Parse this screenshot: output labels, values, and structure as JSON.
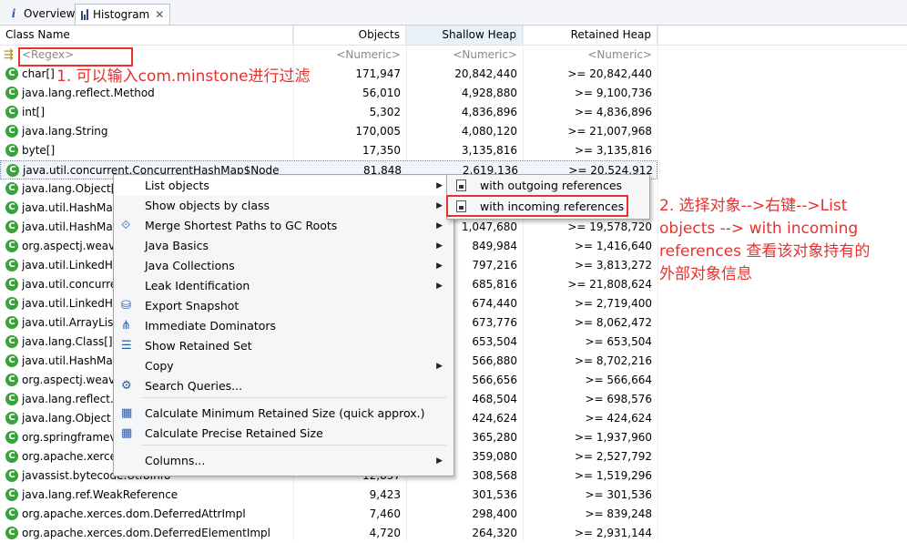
{
  "tabs": [
    {
      "label": "Overview",
      "icon": "info-icon"
    },
    {
      "label": "Histogram",
      "icon": "histogram-icon",
      "active": true
    }
  ],
  "columns": {
    "name": "Class Name",
    "objects": "Objects",
    "shallow": "Shallow Heap",
    "retained": "Retained Heap"
  },
  "filter_row": {
    "name_placeholder": "<Regex>",
    "objects_placeholder": "<Numeric>",
    "shallow_placeholder": "<Numeric>",
    "retained_placeholder": "<Numeric>"
  },
  "rows": [
    {
      "name": "char[]",
      "objects": "171,947",
      "shallow": "20,842,440",
      "retained": ">= 20,842,440"
    },
    {
      "name": "java.lang.reflect.Method",
      "objects": "56,010",
      "shallow": "4,928,880",
      "retained": ">= 9,100,736"
    },
    {
      "name": "int[]",
      "objects": "5,302",
      "shallow": "4,836,896",
      "retained": ">= 4,836,896"
    },
    {
      "name": "java.lang.String",
      "objects": "170,005",
      "shallow": "4,080,120",
      "retained": ">= 21,007,968"
    },
    {
      "name": "byte[]",
      "objects": "17,350",
      "shallow": "3,135,816",
      "retained": ">= 3,135,816"
    },
    {
      "name": "java.util.concurrent.ConcurrentHashMap$Node",
      "objects": "81,848",
      "shallow": "2,619,136",
      "retained": ">= 20,524,912"
    },
    {
      "name": "java.lang.Object[]",
      "objects": "",
      "shallow": "",
      "retained": ""
    },
    {
      "name": "java.util.HashMap",
      "objects": "",
      "shallow": "",
      "retained": ""
    },
    {
      "name": "java.util.HashMap",
      "objects": "",
      "shallow": "1,047,680",
      "retained": ">= 19,578,720"
    },
    {
      "name": "org.aspectj.weave",
      "objects": "",
      "shallow": "849,984",
      "retained": ">= 1,416,640"
    },
    {
      "name": "java.util.LinkedHa",
      "objects": "",
      "shallow": "797,216",
      "retained": ">= 3,813,272"
    },
    {
      "name": "java.util.concurrer",
      "objects": "",
      "shallow": "685,816",
      "retained": ">= 21,808,624"
    },
    {
      "name": "java.util.LinkedHa",
      "objects": "",
      "shallow": "674,440",
      "retained": ">= 2,719,400"
    },
    {
      "name": "java.util.ArrayList",
      "objects": "",
      "shallow": "673,776",
      "retained": ">= 8,062,472"
    },
    {
      "name": "java.lang.Class[]",
      "objects": "",
      "shallow": "653,504",
      "retained": ">= 653,504"
    },
    {
      "name": "java.util.HashMap",
      "objects": "",
      "shallow": "566,880",
      "retained": ">= 8,702,216"
    },
    {
      "name": "org.aspectj.weave",
      "objects": "",
      "shallow": "566,656",
      "retained": ">= 566,664"
    },
    {
      "name": "java.lang.reflect.F",
      "objects": "",
      "shallow": "468,504",
      "retained": ">= 698,576"
    },
    {
      "name": "java.lang.Object",
      "objects": "",
      "shallow": "424,624",
      "retained": ">= 424,624"
    },
    {
      "name": "org.springframev",
      "objects": "",
      "shallow": "365,280",
      "retained": ">= 1,937,960"
    },
    {
      "name": "org.apache.xerce",
      "objects": "",
      "shallow": "359,080",
      "retained": ">= 2,527,792"
    },
    {
      "name": "javassist.bytecode.Utf8Info",
      "objects": "12,857",
      "shallow": "308,568",
      "retained": ">= 1,519,296"
    },
    {
      "name": "java.lang.ref.WeakReference",
      "objects": "9,423",
      "shallow": "301,536",
      "retained": ">= 301,536"
    },
    {
      "name": "org.apache.xerces.dom.DeferredAttrImpl",
      "objects": "7,460",
      "shallow": "298,400",
      "retained": ">= 839,248"
    },
    {
      "name": "org.apache.xerces.dom.DeferredElementImpl",
      "objects": "4,720",
      "shallow": "264,320",
      "retained": ">= 2,931,144"
    }
  ],
  "context_menu": {
    "items": [
      {
        "label": "List objects",
        "icon": "",
        "submenu": true
      },
      {
        "label": "Show objects by class",
        "icon": "",
        "submenu": true
      },
      {
        "label": "Merge Shortest Paths to GC Roots",
        "icon": "merge-paths-icon",
        "submenu": true
      },
      {
        "label": "Java Basics",
        "icon": "",
        "submenu": true
      },
      {
        "label": "Java Collections",
        "icon": "",
        "submenu": true
      },
      {
        "label": "Leak Identification",
        "icon": "",
        "submenu": true
      },
      {
        "label": "Export Snapshot",
        "icon": "database-icon",
        "submenu": false
      },
      {
        "label": "Immediate Dominators",
        "icon": "dominators-icon",
        "submenu": false
      },
      {
        "label": "Show Retained Set",
        "icon": "retained-set-icon",
        "submenu": false
      },
      {
        "label": "Copy",
        "icon": "",
        "submenu": true
      },
      {
        "label": "Search Queries...",
        "icon": "search-queries-icon",
        "submenu": false
      },
      {
        "label": "Calculate Minimum Retained Size (quick approx.)",
        "icon": "calculator-icon",
        "submenu": false
      },
      {
        "label": "Calculate Precise Retained Size",
        "icon": "calculator-icon",
        "submenu": false
      },
      {
        "label": "Columns...",
        "icon": "",
        "submenu": true
      }
    ]
  },
  "submenu": {
    "items": [
      {
        "label": "with outgoing references",
        "icon": "document-icon"
      },
      {
        "label": "with incoming references",
        "icon": "document-icon"
      }
    ]
  },
  "annotations": {
    "note1": "1. 可以输入com.minstone进行过滤",
    "note2_line1": "2. 选择对象-->右键-->List",
    "note2_line2": "objects --> with incoming",
    "note2_line3": "references 查看该对象持有的",
    "note2_line4": "外部对象信息"
  },
  "colors": {
    "annotation_red": "#e8312f",
    "class_icon_green": "#3aa23a",
    "shallow_header_bg": "#e9f1fb"
  }
}
